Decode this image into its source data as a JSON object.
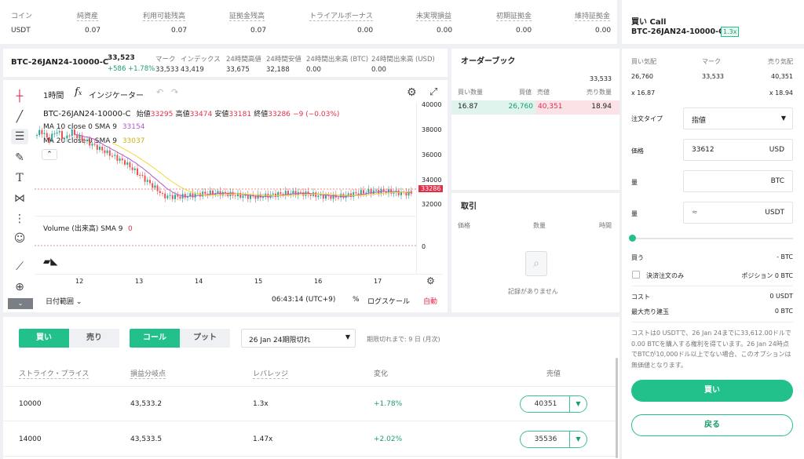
{
  "assets": {
    "headers": [
      "コイン",
      "純資産",
      "利用可能残高",
      "証拠金残高",
      "トライアルボーナス",
      "未実現損益",
      "初期証拠金",
      "維持証拠金"
    ],
    "values": [
      "USDT",
      "0.07",
      "0.07",
      "0.07",
      "0.00",
      "0.00",
      "0.00",
      "0.00"
    ]
  },
  "ticker": {
    "symbol": "BTC-26JAN24-10000-C",
    "price": "33,523",
    "change": "+586 +1.78%",
    "labels": [
      "マーク",
      "インデックス",
      "24時間高値",
      "24時間安値",
      "24時間出来高 (BTC)",
      "24時間出来高 (USD)"
    ],
    "values": [
      "33,533",
      "43,419",
      "33,675",
      "32,188",
      "0.00",
      "0.00"
    ]
  },
  "chart": {
    "interval": "1時間",
    "indicators_label": "インジケーター",
    "symbol": "BTC-26JAN24-10000-C",
    "ohlc_open_label": "始値",
    "ohlc_open": "33295",
    "ohlc_high_label": "高値",
    "ohlc_high": "33474",
    "ohlc_low_label": "安値",
    "ohlc_low": "33181",
    "ohlc_close_label": "終値",
    "ohlc_close": "33286",
    "ohlc_change": "−9 (−0.03%)",
    "ma10_label": "MA 10 close 0 SMA 9",
    "ma10_value": "33154",
    "ma20_label": "MA 20 close 0 SMA 9",
    "ma20_value": "33037",
    "volume_label": "Volume (出来高) SMA 9",
    "volume_value": "0",
    "current_price_tag": "33286",
    "y_ticks": [
      "40000",
      "38000",
      "36000",
      "34000",
      "32000"
    ],
    "vol_tick": "0",
    "x_ticks": [
      "12",
      "13",
      "14",
      "15",
      "16",
      "17"
    ],
    "date_range": "日付範囲",
    "time": "06:43:14 (UTC+9)",
    "percent": "%",
    "log_scale": "ログスケール",
    "auto": "自動",
    "colors": {
      "up": "#26a69a",
      "down": "#ef5350",
      "ma10": "#b15ac9",
      "ma20": "#f2d73b"
    }
  },
  "orderbook": {
    "title": "オーダーブック",
    "top_price": "33,533",
    "headers": [
      "買い数量",
      "買値",
      "売値",
      "売り数量"
    ],
    "row": [
      "16.87",
      "26,760",
      "40,351",
      "18.94"
    ]
  },
  "trades": {
    "title": "取引",
    "headers": [
      "価格",
      "数量",
      "時間"
    ],
    "empty": "記録がありません"
  },
  "options": {
    "buy_tab": "買い",
    "sell_tab": "売り",
    "call_tab": "コール",
    "put_tab": "プット",
    "expiry": "26 Jan 24期限切れ",
    "expiry_note": "期限切れまで: 9 日 (月次)",
    "headers": [
      "ストライク・プライス",
      "損益分岐点",
      "レバレッジ",
      "変化",
      "売値"
    ],
    "rows": [
      {
        "strike": "10000",
        "breakeven": "43,533.2",
        "leverage": "1.3x",
        "change": "+1.78%",
        "price": "40351"
      },
      {
        "strike": "14000",
        "breakeven": "43,533.5",
        "leverage": "1.47x",
        "change": "+2.02%",
        "price": "35536"
      }
    ]
  },
  "panel": {
    "title": "買い Call",
    "symbol": "BTC-26JAN24-10000-C",
    "leverage_badge": "1.3x",
    "quote_headers": [
      "買い気配",
      "マーク",
      "売り気配"
    ],
    "quote_values": [
      "26,760",
      "33,533",
      "40,351"
    ],
    "quote_sizes": [
      "x 16.87",
      "x 18.94"
    ],
    "order_type_label": "注文タイプ",
    "order_type_value": "指値",
    "price_label": "価格",
    "price_value": "33612",
    "price_unit": "USD",
    "qty_label": "量",
    "qty_unit": "BTC",
    "qty2_label": "量",
    "qty2_prefix": "≈",
    "qty2_unit": "USDT",
    "buy_label": "買う",
    "buy_value": "- BTC",
    "settle_only": "決済注文のみ",
    "position_label": "ポジション 0 BTC",
    "cost_label": "コスト",
    "cost_value": "0 USDT",
    "max_short_label": "最大売り建玉",
    "max_short_value": "0 BTC",
    "description": "コストは0 USDTで、26 Jan 24までに33,612.00ドルで0.00 BTCを購入する権利を得ています。26 Jan 24時点でBTCが10,000ドル以上でない場合、このオプションは無価値となります。",
    "buy_button": "買い",
    "back_button": "戻る",
    "accent": "#22c08a"
  }
}
